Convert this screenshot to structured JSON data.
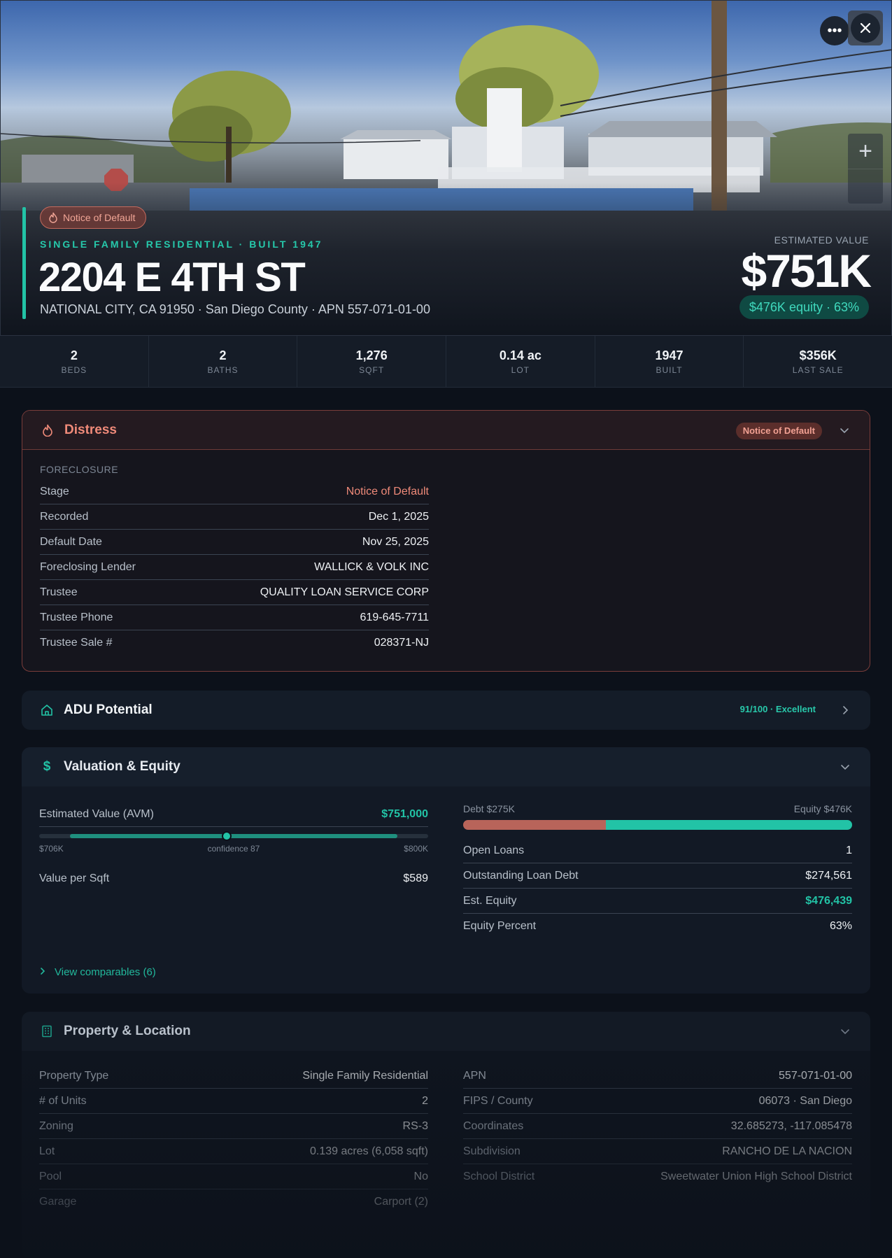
{
  "hero": {
    "status_pill": "Notice of Default",
    "eyebrow": "SINGLE FAMILY RESIDENTIAL · BUILT 1947",
    "title": "2204 E 4TH ST",
    "subtitle": "NATIONAL CITY, CA 91950 · San Diego County · APN 557-071-01-00",
    "estimated_label": "ESTIMATED VALUE",
    "estimated_value": "$751K",
    "equity_pill": "$476K equity · 63%",
    "more_icon": "more-horizontal-icon",
    "close_icon": "close-icon",
    "zoom_in_icon": "plus-icon"
  },
  "stats": [
    {
      "value": "2",
      "label": "BEDS"
    },
    {
      "value": "2",
      "label": "BATHS"
    },
    {
      "value": "1,276",
      "label": "SQFT"
    },
    {
      "value": "0.14 ac",
      "label": "LOT"
    },
    {
      "value": "1947",
      "label": "BUILT"
    },
    {
      "value": "$356K",
      "label": "LAST SALE"
    }
  ],
  "distress": {
    "title": "Distress",
    "badge": "Notice of Default",
    "section_label": "FORECLOSURE",
    "rows": [
      {
        "k": "Stage",
        "v": "Notice of Default"
      },
      {
        "k": "Recorded",
        "v": "Dec 1, 2025"
      },
      {
        "k": "Default Date",
        "v": "Nov 25, 2025"
      },
      {
        "k": "Foreclosing Lender",
        "v": "WALLICK & VOLK INC"
      },
      {
        "k": "Trustee",
        "v": "QUALITY LOAN SERVICE CORP"
      },
      {
        "k": "Trustee Phone",
        "v": "619-645-7711"
      },
      {
        "k": "Trustee Sale #",
        "v": "028371-NJ"
      }
    ],
    "accent_color": "#ef8a79"
  },
  "adu": {
    "title": "ADU Potential",
    "score": "91/100 · Excellent"
  },
  "valuation": {
    "title": "Valuation & Equity",
    "avm_label": "Estimated Value (AVM)",
    "avm_value": "$751,000",
    "range_low": "$706K",
    "range_high": "$800K",
    "confidence": "confidence 87",
    "range_low_num": 706,
    "range_high_num": 800,
    "avm_num": 751,
    "value_per_sqft_label": "Value per Sqft",
    "value_per_sqft": "$589",
    "debt_label": "Debt $275K",
    "equity_label": "Equity $476K",
    "debt_num": 275,
    "equity_num": 476,
    "rows": [
      {
        "k": "Open Loans",
        "v": "1"
      },
      {
        "k": "Outstanding Loan Debt",
        "v": "$274,561"
      },
      {
        "k": "Est. Equity",
        "v": "$476,439"
      },
      {
        "k": "Equity Percent",
        "v": "63%"
      }
    ],
    "comps_link": "View comparables (6)",
    "debt_color": "#b8645a",
    "equity_color": "#22c3a6"
  },
  "property": {
    "title": "Property & Location",
    "left_rows": [
      {
        "k": "Property Type",
        "v": "Single Family Residential"
      },
      {
        "k": "# of Units",
        "v": "2"
      },
      {
        "k": "Zoning",
        "v": "RS-3"
      },
      {
        "k": "Lot",
        "v": "0.139 acres (6,058 sqft)"
      },
      {
        "k": "Pool",
        "v": "No"
      },
      {
        "k": "Garage",
        "v": "Carport (2)"
      }
    ],
    "right_rows": [
      {
        "k": "APN",
        "v": "557-071-01-00"
      },
      {
        "k": "FIPS / County",
        "v": "06073 · San Diego"
      },
      {
        "k": "Coordinates",
        "v": "32.685273, -117.085478"
      },
      {
        "k": "Subdivision",
        "v": "RANCHO DE LA NACION"
      },
      {
        "k": "School District",
        "v": "Sweetwater Union High School District"
      }
    ]
  }
}
